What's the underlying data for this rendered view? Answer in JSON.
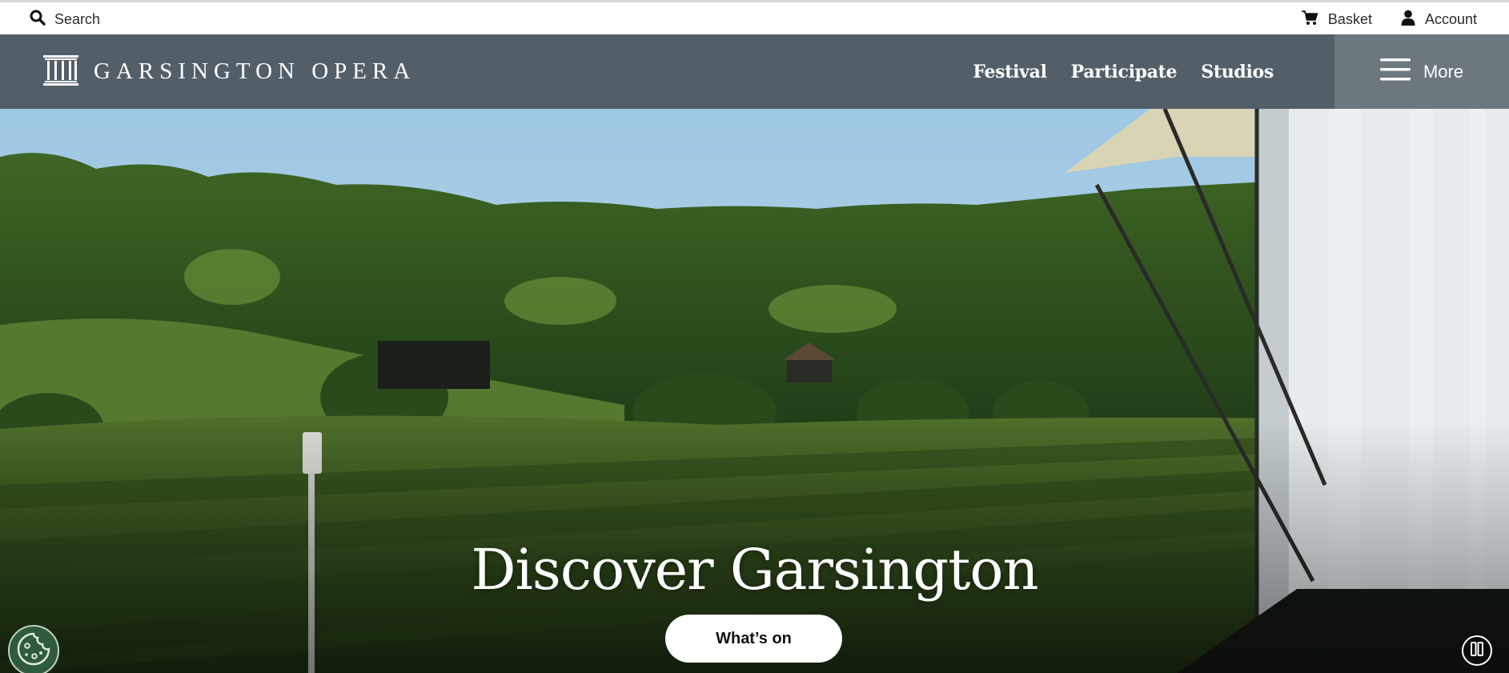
{
  "utility": {
    "search_label": "Search",
    "basket_label": "Basket",
    "account_label": "Account"
  },
  "nav": {
    "brand": "GARSINGTON OPERA",
    "links": [
      {
        "label": "Festival"
      },
      {
        "label": "Participate"
      },
      {
        "label": "Studios"
      }
    ],
    "more_label": "More"
  },
  "hero": {
    "title": "Discover Garsington",
    "cta_label": "What’s on"
  },
  "colors": {
    "nav_background": "#535f68",
    "more_background": "#6c777e",
    "cookie_button": "#2f5a3c"
  },
  "icons": [
    "search-icon",
    "cart-icon",
    "user-icon",
    "columns-logo-icon",
    "hamburger-icon",
    "cookie-icon",
    "pause-icon"
  ]
}
